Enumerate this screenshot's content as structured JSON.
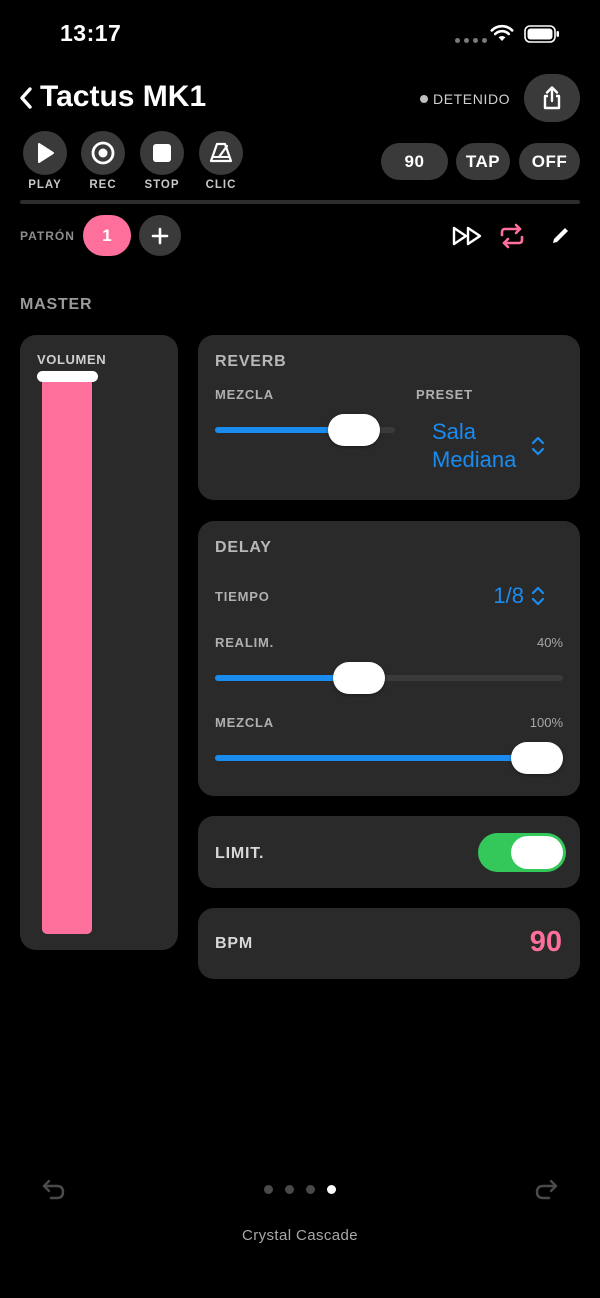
{
  "status_bar": {
    "time": "13:17"
  },
  "header": {
    "title": "Tactus MK1",
    "status": "DETENIDO"
  },
  "transport": {
    "play": "PLAY",
    "rec": "REC",
    "stop": "STOP",
    "clic": "CLIC",
    "tempo": "90",
    "tap": "TAP",
    "metronome": "OFF"
  },
  "pattern": {
    "label": "PATRÓN",
    "current": "1"
  },
  "master": {
    "section_title": "MASTER",
    "volume_label": "VOLUMEN",
    "volume_level": 1.0
  },
  "reverb": {
    "title": "REVERB",
    "mix_label": "MEZCLA",
    "mix_level": 0.85,
    "preset_label": "PRESET",
    "preset_line1": "Sala",
    "preset_line2": "Mediana"
  },
  "delay": {
    "title": "DELAY",
    "time_label": "TIEMPO",
    "time_value": "1/8",
    "feedback_label": "REALIM.",
    "feedback_value": "40%",
    "feedback_level": 0.4,
    "mix_label": "MEZCLA",
    "mix_value": "100%",
    "mix_level": 1.0
  },
  "limiter": {
    "label": "LIMIT.",
    "on": true
  },
  "bpm": {
    "label": "BPM",
    "value": "90"
  },
  "footer": {
    "page_count": 4,
    "active_page": 4,
    "label": "Crystal Cascade"
  },
  "colors": {
    "accent_pink": "#ff6f9c",
    "accent_blue": "#1a8cf0",
    "toggle_green": "#34c759",
    "card_bg": "#2a2a2a"
  }
}
